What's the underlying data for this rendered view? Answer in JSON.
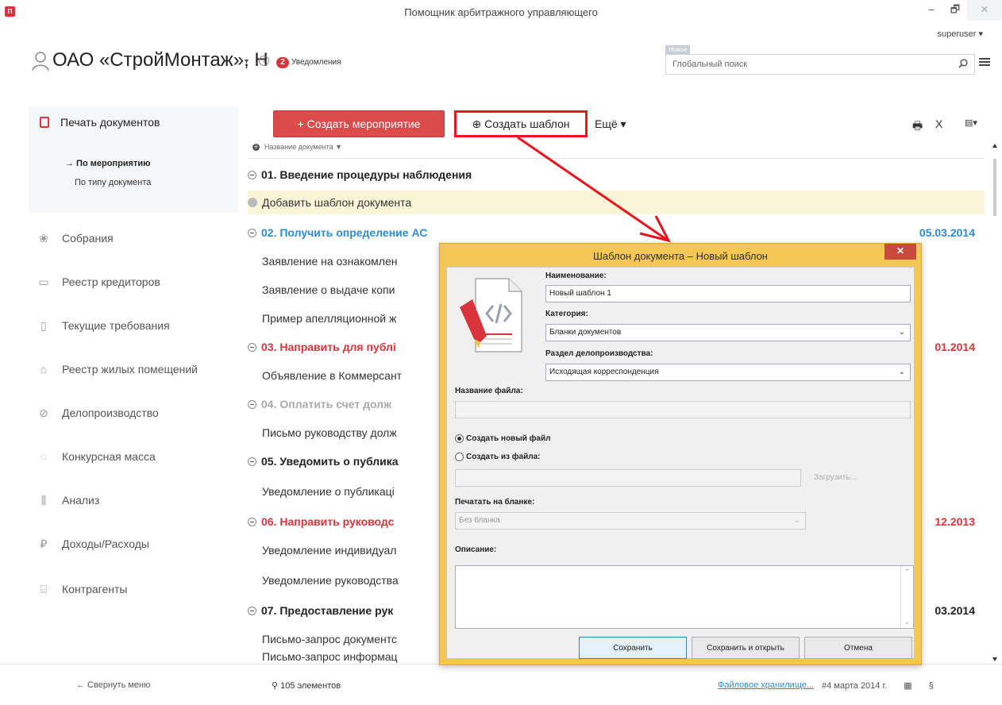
{
  "window": {
    "title": "Помощник арбитражного управляющего",
    "app_icon_text": "П",
    "minimize": "–",
    "restore": "🗗",
    "close": "✕",
    "user": "superuser ▾"
  },
  "header": {
    "company": "ОАО «СтройМонтаж», Н",
    "company_caret": "▾",
    "info_icon": "i",
    "notif_count": "2",
    "notif_label": "Уведомления",
    "search_new_badge": "Новое",
    "search_placeholder": "Глобальный поиск"
  },
  "sidebar": {
    "active_title": "Печать документов",
    "sub_items": [
      "→ По мероприятию",
      "По типу документа"
    ],
    "items": [
      {
        "label": "Собрания",
        "icon": "❀"
      },
      {
        "label": "Реестр кредиторов",
        "icon": "▭"
      },
      {
        "label": "Текущие требования",
        "icon": "▯"
      },
      {
        "label": "Реестр жилых помещений",
        "icon": "⌂"
      },
      {
        "label": "Делопроизводство",
        "icon": "⊘"
      },
      {
        "label": "Конкурсная масса",
        "icon": "◌"
      },
      {
        "label": "Анализ",
        "icon": "⫼"
      },
      {
        "label": "Доходы/Расходы",
        "icon": "₽"
      },
      {
        "label": "Контрагенты",
        "icon": "⌸"
      }
    ],
    "collapse": "←  Свернуть меню"
  },
  "toolbar": {
    "create_event": "+ Создать мероприятие",
    "create_template": "⊕ Создать шаблон",
    "more": "Ещё ▾",
    "print_icon": "🖶",
    "excel_icon": "X",
    "export_icon": "▤▾"
  },
  "list": {
    "column_header": "Название документа ▼",
    "rows": [
      {
        "type": "group",
        "text": "01. Введение процедуры наблюдения",
        "date": ""
      },
      {
        "type": "add",
        "text": "Добавить шаблон документа"
      },
      {
        "type": "group",
        "text": "02. Получить определение АС",
        "date": "05.03.2014"
      },
      {
        "type": "item",
        "text": "Заявление на ознакомлен"
      },
      {
        "type": "item",
        "text": "Заявление о выдаче копи"
      },
      {
        "type": "item",
        "text": "Пример апелляционной ж"
      },
      {
        "type": "group",
        "text": "03. Направить для публі",
        "date": "01.2014"
      },
      {
        "type": "item",
        "text": "Объявление в Коммерсант"
      },
      {
        "type": "group",
        "text": "04. Оплатить счет долж",
        "date": ""
      },
      {
        "type": "item",
        "text": "Письмо руководству долж"
      },
      {
        "type": "group",
        "text": "05. Уведомить о публика",
        "date": ""
      },
      {
        "type": "item",
        "text": "Уведомление о публикаці"
      },
      {
        "type": "group",
        "text": "06. Направить руководс",
        "date": "12.2013"
      },
      {
        "type": "item",
        "text": "Уведомление индивидуал"
      },
      {
        "type": "item",
        "text": "Уведомление руководства"
      },
      {
        "type": "group",
        "text": "07. Предоставление рук",
        "date": "03.2014"
      },
      {
        "type": "item",
        "text": "Письмо-запрос документс"
      },
      {
        "type": "item",
        "text": "Письмо-запрос информац"
      }
    ]
  },
  "footer": {
    "count": "105 элементов",
    "storage": "Файловое хранилище...",
    "date": "4 марта 2014 г.",
    "calc_icon": "▦",
    "section_icon": "§"
  },
  "dialog": {
    "title": "Шаблон документа – Новый шаблон",
    "close": "✕",
    "name_label": "Наименование:",
    "name_value": "Новый шаблон 1",
    "category_label": "Категория:",
    "category_value": "Бланки документов",
    "section_label": "Раздел делопроизводства:",
    "section_value": "Исходящая корреспонденция",
    "filename_label": "Название файла:",
    "filename_value": "",
    "radio_new": "Создать новый файл",
    "radio_from": "Создать из файла:",
    "upload": "Загрузить...",
    "print_label": "Печатать на бланке:",
    "print_value": "Без бланка",
    "desc_label": "Описание:",
    "btn_save": "Сохранить",
    "btn_save_open": "Сохранить и открыть",
    "btn_cancel": "Отмена"
  },
  "colors": {
    "accent_red": "#db4b4b",
    "link_blue": "#2e8bcf",
    "dialog_frame": "#f4c654",
    "highlight_row": "#fbf6d8"
  }
}
